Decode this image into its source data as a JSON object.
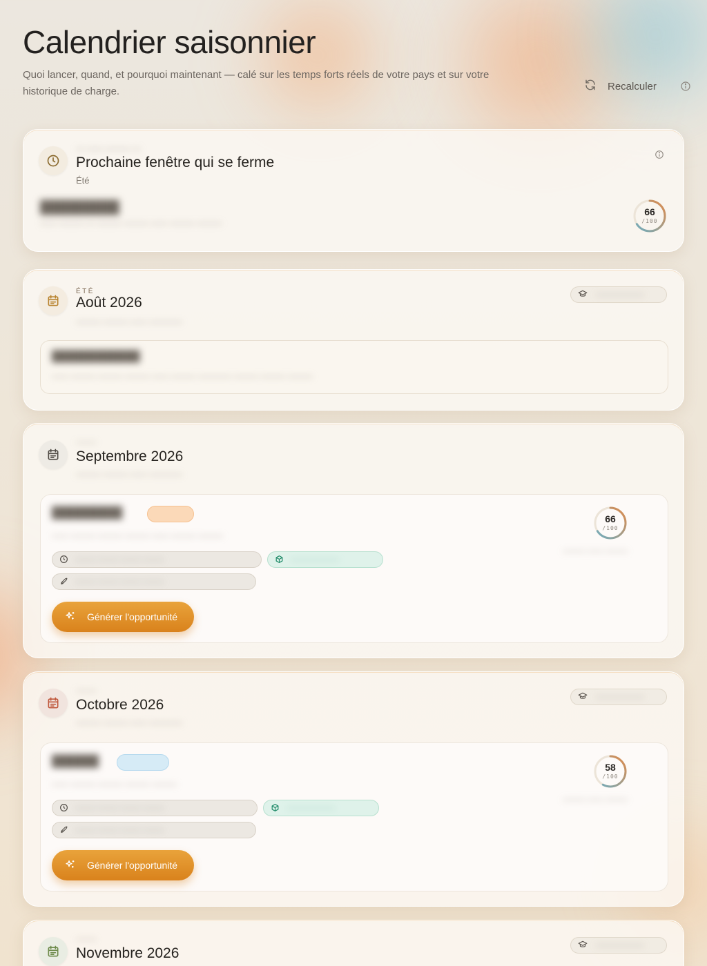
{
  "header": {
    "title": "Calendrier saisonnier",
    "subtitle": "Quoi lancer, quand, et pourquoi maintenant — calé sur les temps forts réels de votre pays et sur votre historique de charge.",
    "recalc_label": "Recalculer"
  },
  "next_window": {
    "title": "Prochaine fenêtre qui se ferme",
    "season": "Été",
    "score": 66,
    "score_max": "/100"
  },
  "months": [
    {
      "kicker": "ÉTÉ",
      "title": "Août 2026"
    },
    {
      "title": "Septembre 2026",
      "score": 66,
      "score_max": "/100",
      "button_label": "Générer l'opportunité"
    },
    {
      "title": "Octobre 2026",
      "score": 58,
      "score_max": "/100",
      "button_label": "Générer l'opportunité"
    },
    {
      "title": "Novembre 2026"
    }
  ],
  "colors": {
    "accent": "#d9821c",
    "score_ring_start": "#e08a4a",
    "score_ring_end": "#6aaec4"
  }
}
